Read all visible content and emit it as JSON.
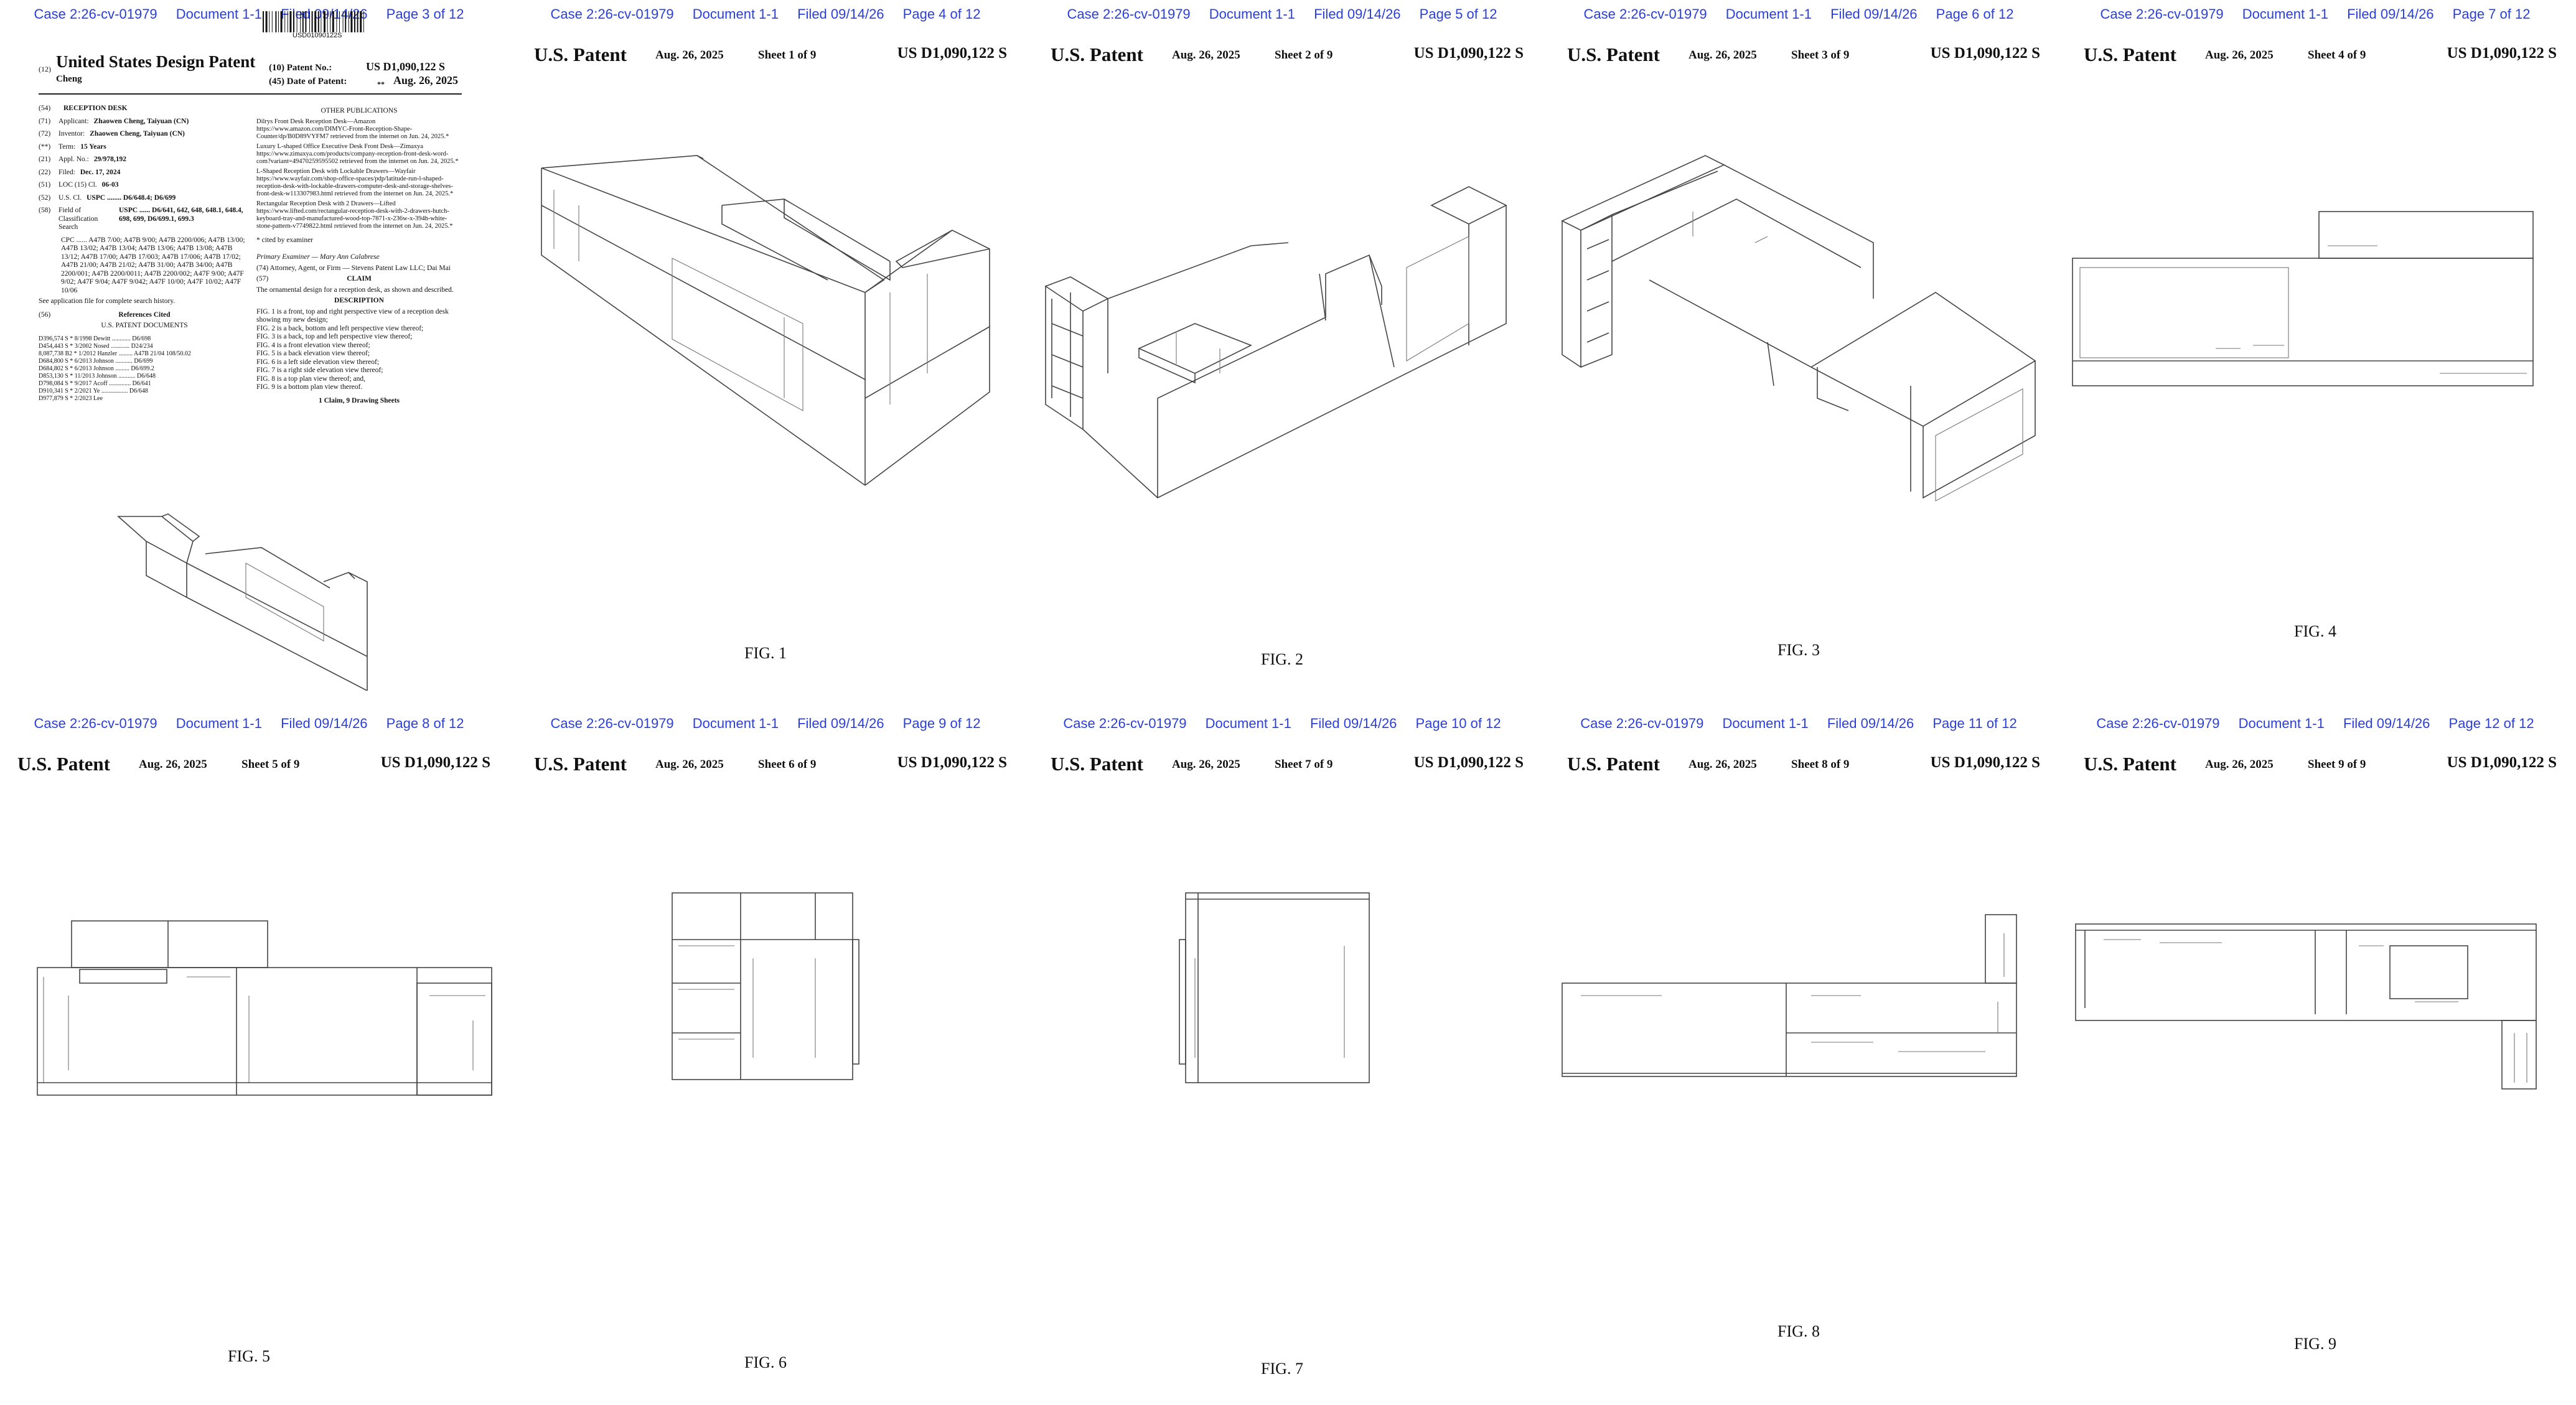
{
  "case_header": {
    "case": "Case 2:26-cv-01979",
    "document": "Document 1-1",
    "filed": "Filed 09/14/26",
    "pages": [
      "Page 3 of 12",
      "Page 4 of 12",
      "Page 5 of 12",
      "Page 6 of 12",
      "Page 7 of 12",
      "Page 8 of 12",
      "Page 9 of 12",
      "Page 10 of 12",
      "Page 11 of 12",
      "Page 12 of 12"
    ]
  },
  "sheet_header": {
    "label": "U.S. Patent",
    "date": "Aug. 26, 2025",
    "number": "US D1,090,122 S",
    "sheets": [
      "Sheet 1 of 9",
      "Sheet 2 of 9",
      "Sheet 3 of 9",
      "Sheet 4 of 9",
      "Sheet 5 of 9",
      "Sheet 6 of 9",
      "Sheet 7 of 9",
      "Sheet 8 of 9",
      "Sheet 9 of 9"
    ]
  },
  "figures": [
    "FIG. 1",
    "FIG. 2",
    "FIG. 3",
    "FIG. 4",
    "FIG. 5",
    "FIG. 6",
    "FIG. 7",
    "FIG. 8",
    "FIG. 9"
  ],
  "front_page": {
    "barcode_text": "USD01090122S",
    "kind_12": "(12)",
    "title": "United States Design Patent",
    "inventor_surname": "Cheng",
    "patent_no_label": "(10) Patent No.:",
    "patent_no": "US D1,090,122 S",
    "date_label": "(45) Date of Patent:",
    "date_mark": "**",
    "date": "Aug. 26, 2025",
    "fields": [
      {
        "code": "(54)",
        "label": "",
        "value": "RECEPTION DESK"
      },
      {
        "code": "(71)",
        "label": "Applicant:",
        "value": "Zhaowen Cheng, Taiyuan (CN)"
      },
      {
        "code": "(72)",
        "label": "Inventor:",
        "value": "Zhaowen Cheng, Taiyuan (CN)"
      },
      {
        "code": "(**)",
        "label": "Term:",
        "value": "15 Years"
      },
      {
        "code": "(21)",
        "label": "Appl. No.:",
        "value": "29/978,192"
      },
      {
        "code": "(22)",
        "label": "Filed:",
        "value": "Dec. 17, 2024"
      },
      {
        "code": "(51)",
        "label": "LOC (15) Cl.",
        "value": "06-03"
      },
      {
        "code": "(52)",
        "label": "U.S. Cl.",
        "value": "USPC ........ D6/648.4; D6/699"
      },
      {
        "code": "(58)",
        "label": "Field of Classification Search",
        "value": "USPC ...... D6/641, 642, 648, 648.1, 648.4, 698, 699, D6/699.1, 699.3"
      }
    ],
    "cpc": "CPC ...... A47B 7/00; A47B 9/00; A47B 2200/006; A47B 13/00; A47B 13/02; A47B 13/04; A47B 13/06; A47B 13/08; A47B 13/12; A47B 17/00; A47B 17/003; A47B 17/006; A47B 17/02; A47B 21/00; A47B 21/02; A47B 31/00; A47B 34/00; A47B 2200/001; A47B 2200/0011; A47B 2200/002; A47F 9/00; A47F 9/02; A47F 9/04; A47F 9/042; A47F 10/00; A47F 10/02; A47F 10/06",
    "search_history": "See application file for complete search history.",
    "refs_code": "(56)",
    "refs_heading": "References Cited",
    "refs_sub": "U.S. PATENT DOCUMENTS",
    "references": [
      "D396,574 S * 8/1998 Dewitt ............ D6/698",
      "D454,443 S * 3/2002 Nosed ............ D24/234",
      "8,087,738 B2 * 1/2012 Hanzler ......... A47B 21/04 108/50.02",
      "D684,800 S * 6/2013 Johnson ........... D6/699",
      "D684,802 S * 6/2013 Johnson ......... D6/699.2",
      "D853,130 S * 11/2013 Johnson ........... D6/648",
      "D798,084 S * 9/2017 Acoff .............. D6/641",
      "D910,341 S * 2/2021 Ye ................. D6/648",
      "D977,879 S * 2/2023 Lee"
    ],
    "other_pubs_heading": "OTHER PUBLICATIONS",
    "other_pubs": [
      "Dilrys Front Desk Reception Desk—Amazon https://www.amazon.com/DIMYC-Front-Reception-Shape-Counter/dp/B0D89VYFM7 retrieved from the internet on Jun. 24, 2025.*",
      "Luxury L-shaped Office Executive Desk Front Desk—Zimaxya https://www.zimaxya.com/products/company-reception-front-desk-word-com?variant=49470259595502 retrieved from the internet on Jun. 24, 2025.*",
      "L-Shaped Reception Desk with Lockable Drawers—Wayfair https://www.wayfair.com/shop-office-spaces/pdp/latitude-run-l-shaped-reception-desk-with-lockable-drawers-computer-desk-and-storage-shelves-front-desk-w113307983.html retrieved from the internet on Jun. 24, 2025.*",
      "Rectangular Reception Desk with 2 Drawers—Lifted https://www.lifted.com/rectangular-reception-desk-with-2-drawers-hutch-keyboard-tray-and-manufactured-wood-top-7871-x-236w-x-394h-white-stone-pattern-v7749822.html retrieved from the internet on Jun. 24, 2025.*"
    ],
    "cited_by": "* cited by examiner",
    "examiner": "Primary Examiner — Mary Ann Calabrese",
    "attorney": "(74) Attorney, Agent, or Firm — Stevens Patent Law LLC; Dai Mai",
    "claim_code": "(57)",
    "claim_heading": "CLAIM",
    "claim_text": "The ornamental design for a reception desk, as shown and described.",
    "description_heading": "DESCRIPTION",
    "description": [
      "FIG. 1 is a front, top and right perspective view of a reception desk showing my new design;",
      "FIG. 2 is a back, bottom and left perspective view thereof;",
      "FIG. 3 is a back, top and left perspective view thereof;",
      "FIG. 4 is a front elevation view thereof;",
      "FIG. 5 is a back elevation view thereof;",
      "FIG. 6 is a left side elevation view thereof;",
      "FIG. 7 is a right side elevation view thereof;",
      "FIG. 8 is a top plan view thereof; and,",
      "FIG. 9 is a bottom plan view thereof."
    ],
    "claims_count": "1 Claim, 9 Drawing Sheets"
  }
}
